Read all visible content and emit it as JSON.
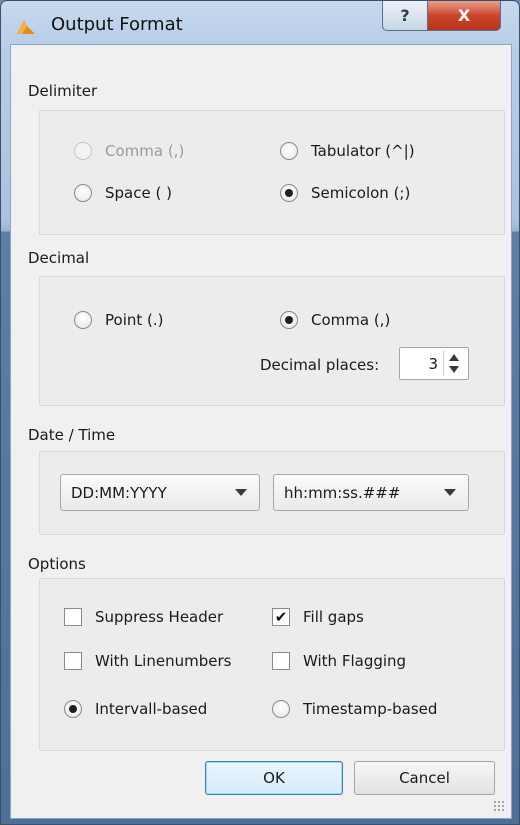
{
  "window": {
    "title": "Output Format",
    "help_label": "?",
    "close_label": "X"
  },
  "delimiter": {
    "title": "Delimiter",
    "options": [
      {
        "label": "Comma (,)",
        "checked": false,
        "disabled": true
      },
      {
        "label": "Tabulator (^|)",
        "checked": false,
        "disabled": false
      },
      {
        "label": "Space ( )",
        "checked": false,
        "disabled": false
      },
      {
        "label": "Semicolon (;)",
        "checked": true,
        "disabled": false
      }
    ]
  },
  "decimal": {
    "title": "Decimal",
    "options": [
      {
        "label": "Point (.)",
        "checked": false
      },
      {
        "label": "Comma (,)",
        "checked": true
      }
    ],
    "places_label": "Decimal places:",
    "places_value": "3"
  },
  "datetime": {
    "title": "Date / Time",
    "date_format": "DD:MM:YYYY",
    "time_format": "hh:mm:ss.###"
  },
  "options": {
    "title": "Options",
    "checkboxes": [
      {
        "label": "Suppress Header",
        "checked": false
      },
      {
        "label": "Fill gaps",
        "checked": true
      },
      {
        "label": "With Linenumbers",
        "checked": false
      },
      {
        "label": "With Flagging",
        "checked": false
      }
    ],
    "radios": [
      {
        "label": "Intervall-based",
        "checked": true
      },
      {
        "label": "Timestamp-based",
        "checked": false
      }
    ],
    "check_mark": "✔"
  },
  "buttons": {
    "ok": "OK",
    "cancel": "Cancel"
  },
  "colors": {
    "accent_default_button": "#3c7fb1",
    "close_button": "#c9462c"
  }
}
